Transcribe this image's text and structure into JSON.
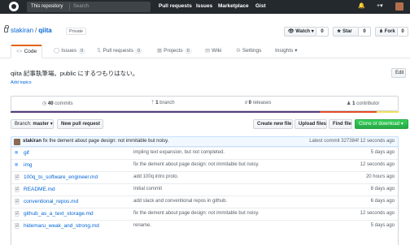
{
  "topbar": {
    "search_scope": "This repository",
    "search_placeholder": "Search",
    "nav": [
      "Pull requests",
      "Issues",
      "Marketplace",
      "Gist"
    ],
    "icons": [
      "bell-icon",
      "plus-icon",
      "avatar"
    ]
  },
  "repo": {
    "owner": "stakiran",
    "separator": "/",
    "name": "qiita",
    "visibility": "Private",
    "watch_label": "Watch",
    "watch_count": "0",
    "star_label": "Star",
    "star_count": "0",
    "fork_label": "Fork",
    "fork_count": "0",
    "description": "qiita 記事執筆場。public にするつもりはない。",
    "edit_label": "Edit",
    "add_topics": "Add topics"
  },
  "tabs": [
    {
      "label": "Code",
      "count": "",
      "icon": "code-icon",
      "selected": true
    },
    {
      "label": "Issues",
      "count": "0",
      "icon": "issue-icon",
      "selected": false
    },
    {
      "label": "Pull requests",
      "count": "0",
      "icon": "pr-icon",
      "selected": false
    },
    {
      "label": "Projects",
      "count": "0",
      "icon": "project-icon",
      "selected": false
    },
    {
      "label": "Wiki",
      "count": "",
      "icon": "wiki-icon",
      "selected": false
    },
    {
      "label": "Settings",
      "count": "",
      "icon": "gear-icon",
      "selected": false
    },
    {
      "label": "Insights",
      "count": "",
      "icon": "chevron-down-icon",
      "selected": false
    }
  ],
  "summary": {
    "commits_count": "40",
    "commits_label": "commits",
    "branch_count": "1",
    "branch_label": "branch",
    "releases_count": "0",
    "releases_label": "releases",
    "contributor_count": "1",
    "contributor_label": "contributor"
  },
  "language_colors": [
    "#563d7c",
    "#e34c26",
    "#f1e05a"
  ],
  "filenav": {
    "branch_label": "Branch:",
    "branch_value": "master",
    "new_pr": "New pull request",
    "create_file": "Create new file",
    "upload_files": "Upload files",
    "find_file": "Find file",
    "clone": "Clone or download"
  },
  "latest_commit": {
    "author": "stakiran",
    "message": "fix the dement about page design: not immitable but noisy.",
    "label": "Latest commit",
    "sha": "327384f",
    "time": "12 seconds ago"
  },
  "files": [
    {
      "type": "dir",
      "name": "gif",
      "message": "impling text expansion, but not completed.",
      "age": "5 days ago"
    },
    {
      "type": "dir",
      "name": "img",
      "message": "fix the dement about page design: not immitable but noisy.",
      "age": "12 seconds ago"
    },
    {
      "type": "file",
      "name": "100q_to_software_engineer.md",
      "message": "add 100q intro proto.",
      "age": "20 hours ago"
    },
    {
      "type": "file",
      "name": "README.md",
      "message": "Initial commit",
      "age": "8 days ago"
    },
    {
      "type": "file",
      "name": "conventional_repos.md",
      "message": "add slack and conventional repos in github.",
      "age": "6 days ago"
    },
    {
      "type": "file",
      "name": "github_as_a_text_storage.md",
      "message": "fix the dement about page design: not immitable but noisy.",
      "age": "12 seconds ago"
    },
    {
      "type": "file",
      "name": "hidemaru_weak_and_strong.md",
      "message": "rename.",
      "age": "5 days ago"
    }
  ]
}
